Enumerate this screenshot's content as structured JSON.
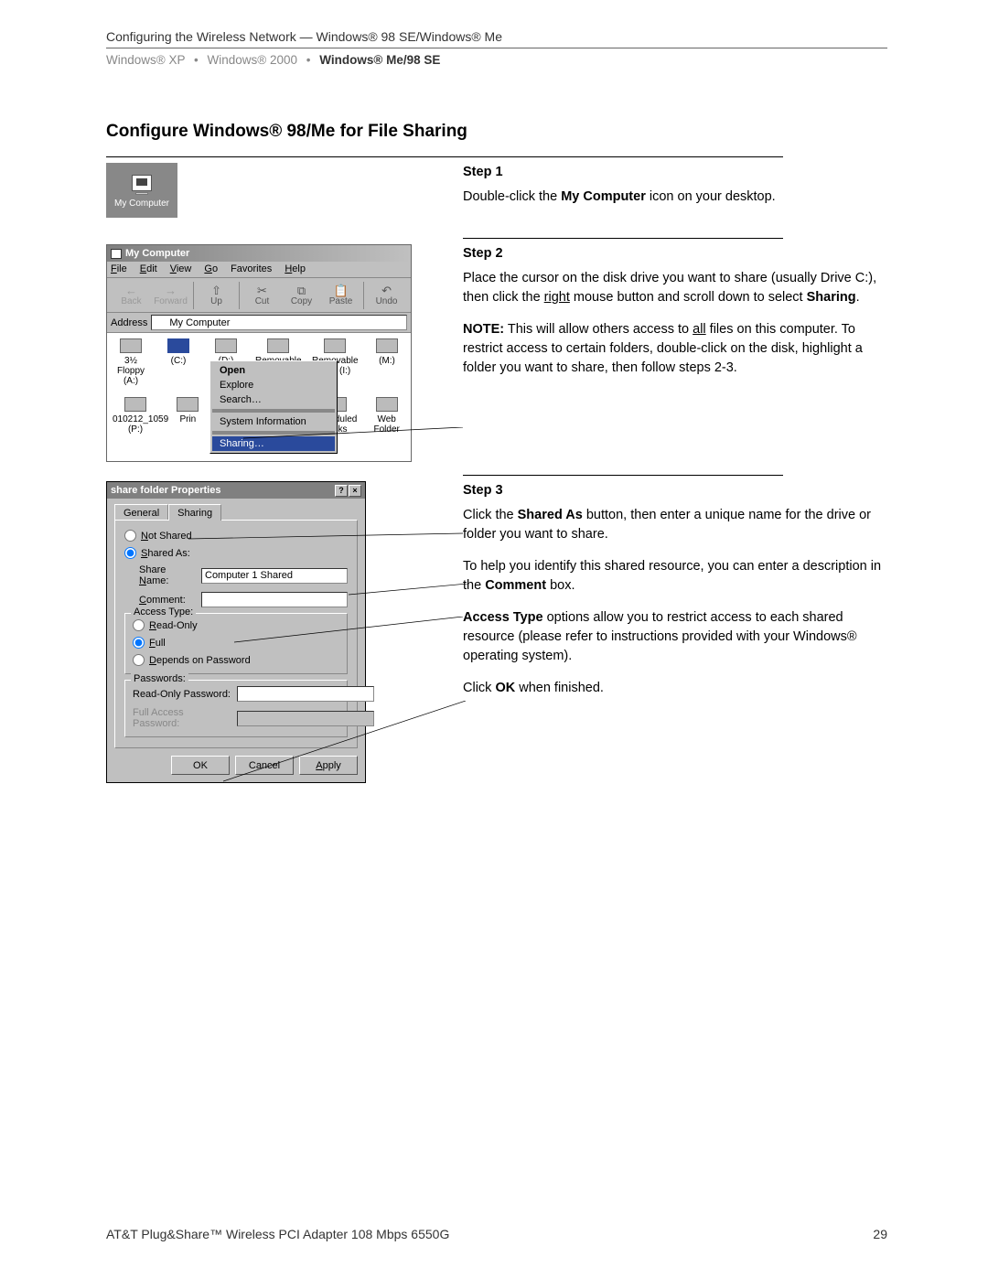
{
  "header": {
    "line1": "Configuring the Wireless Network — Windows® 98 SE/Windows® Me",
    "breadcrumb": {
      "item1": "Windows® XP",
      "item2": "Windows® 2000",
      "item3": "Windows® Me/98 SE",
      "sep": "•"
    }
  },
  "section_title": "Configure Windows® 98/Me for File Sharing",
  "desktop_icon": {
    "label": "My Computer"
  },
  "step1": {
    "title": "Step 1",
    "p1a": "Double-click the ",
    "p1b": "My Computer",
    "p1c": " icon on your desktop."
  },
  "explorer": {
    "title": "My Computer",
    "menus": {
      "file": "File",
      "edit": "Edit",
      "view": "View",
      "go": "Go",
      "fav": "Favorites",
      "help": "Help"
    },
    "toolbar": {
      "back": {
        "g": "←",
        "l": "Back"
      },
      "forward": {
        "g": "→",
        "l": "Forward"
      },
      "up": {
        "g": "⇧",
        "l": "Up"
      },
      "cut": {
        "g": "✂",
        "l": "Cut"
      },
      "copy": {
        "g": "⧉",
        "l": "Copy"
      },
      "paste": {
        "g": "📋",
        "l": "Paste"
      },
      "undo": {
        "g": "↶",
        "l": "Undo"
      }
    },
    "addr_label": "Address",
    "addr_value": "My Computer",
    "drives": {
      "a": "3½ Floppy (A:)",
      "c": "(C:)",
      "d": "(D:)",
      "rem": "Removable",
      "i": "Removable Disk (I:)",
      "m": "(M:)",
      "p": "010212_1059 (P:)",
      "prn": "Prin",
      "sched": "Scheduled Tasks",
      "web": "Web Folder"
    },
    "ctx": {
      "open": "Open",
      "explore": "Explore",
      "search": "Search…",
      "sysinfo": "System Information",
      "sharing": "Sharing…"
    }
  },
  "step2": {
    "title": "Step 2",
    "p1a": "Place the cursor on the disk drive you want to share (usually Drive C:), then click the ",
    "p1u": "right",
    "p1b": " mouse button and scroll down to select ",
    "p1c": "Sharing",
    "p1d": ".",
    "p2a": "NOTE:",
    "p2b": " This will allow others access to ",
    "p2u": "all",
    "p2c": " files on this computer. To restrict access to certain folders, double-click on the disk, highlight a folder you want to share, then follow steps 2-3."
  },
  "dlg": {
    "title": "share folder Properties",
    "help": "?",
    "close": "×",
    "tab_general": "General",
    "tab_sharing": "Sharing",
    "not_shared": "Not Shared",
    "shared_as": "Shared As:",
    "share_name_l": "Share Name:",
    "share_name_v": "Computer 1 Shared",
    "comment_l": "Comment:",
    "comment_v": "",
    "access_type": "Access Type:",
    "ro": "Read-Only",
    "full": "Full",
    "dep": "Depends on Password",
    "pw": "Passwords:",
    "ropw_l": "Read-Only Password:",
    "ropw_v": "",
    "fapw_l": "Full Access Password:",
    "fapw_v": "",
    "ok": "OK",
    "cancel": "Cancel",
    "apply": "Apply"
  },
  "step3": {
    "title": "Step 3",
    "p1a": "Click the ",
    "p1b": "Shared As",
    "p1c": " button, then enter a unique name for the drive or folder you want to share.",
    "p2a": "To help you identify this shared resource, you can enter a description in the ",
    "p2b": "Comment",
    "p2c": " box.",
    "p3a": "Access Type",
    "p3b": " options allow you to restrict access to each shared resource (please refer to instructions provided with your Windows® operating system).",
    "p4a": "Click ",
    "p4b": "OK",
    "p4c": " when finished."
  },
  "footer": {
    "left": "AT&T Plug&Share™ Wireless PCI Adapter 108 Mbps 6550G",
    "right": "29"
  }
}
